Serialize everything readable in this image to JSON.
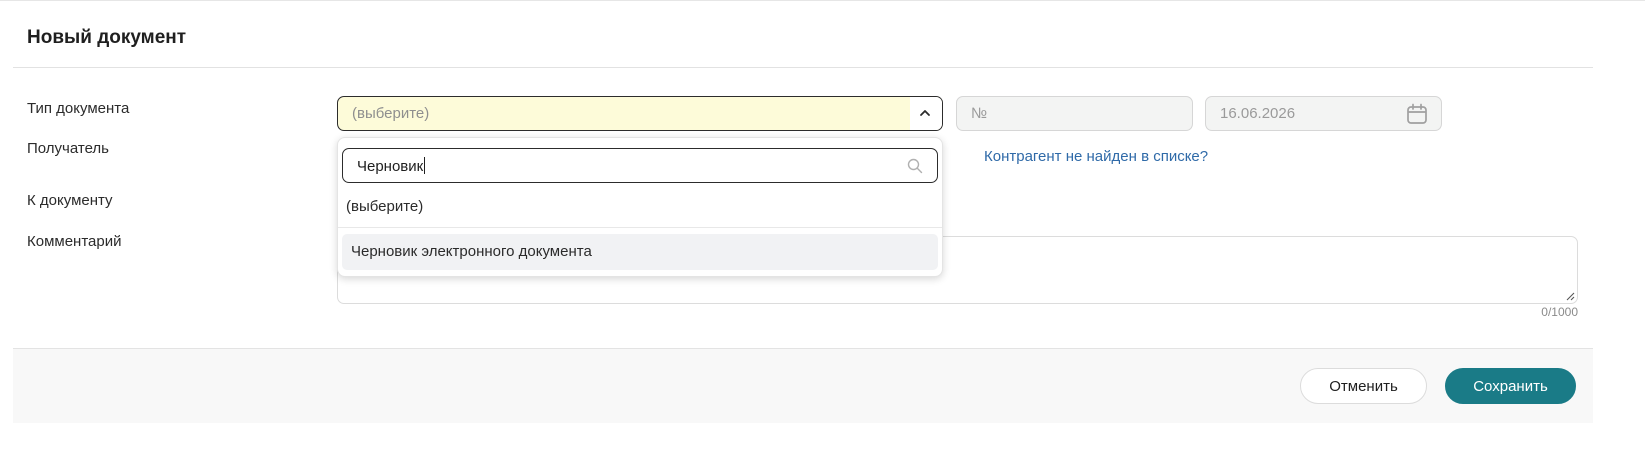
{
  "form": {
    "title": "Новый документ",
    "labels": {
      "doc_type": "Тип документа",
      "recipient": "Получатель",
      "to_document": "К документу",
      "comment": "Комментарий"
    },
    "doc_type_select": {
      "placeholder": "(выберите)",
      "expanded": true
    },
    "number_field": {
      "placeholder": "№"
    },
    "date_field": {
      "value": "16.06.2026"
    },
    "counterparty_link": "Контрагент не найден в списке?",
    "comment_counter": "0/1000"
  },
  "dropdown": {
    "search_value": "Черновик",
    "options": [
      "(выберите)",
      "Черновик электронного документа"
    ],
    "highlighted_index": 1
  },
  "actions": {
    "cancel_label": "Отменить",
    "save_label": "Сохранить"
  },
  "colors": {
    "accent": "#1a7b87",
    "select_bg": "#fdfbd9",
    "link": "#2f6aa8"
  },
  "icons": [
    "chevron-up-icon",
    "calendar-icon",
    "search-icon",
    "resize-handle-icon"
  ]
}
